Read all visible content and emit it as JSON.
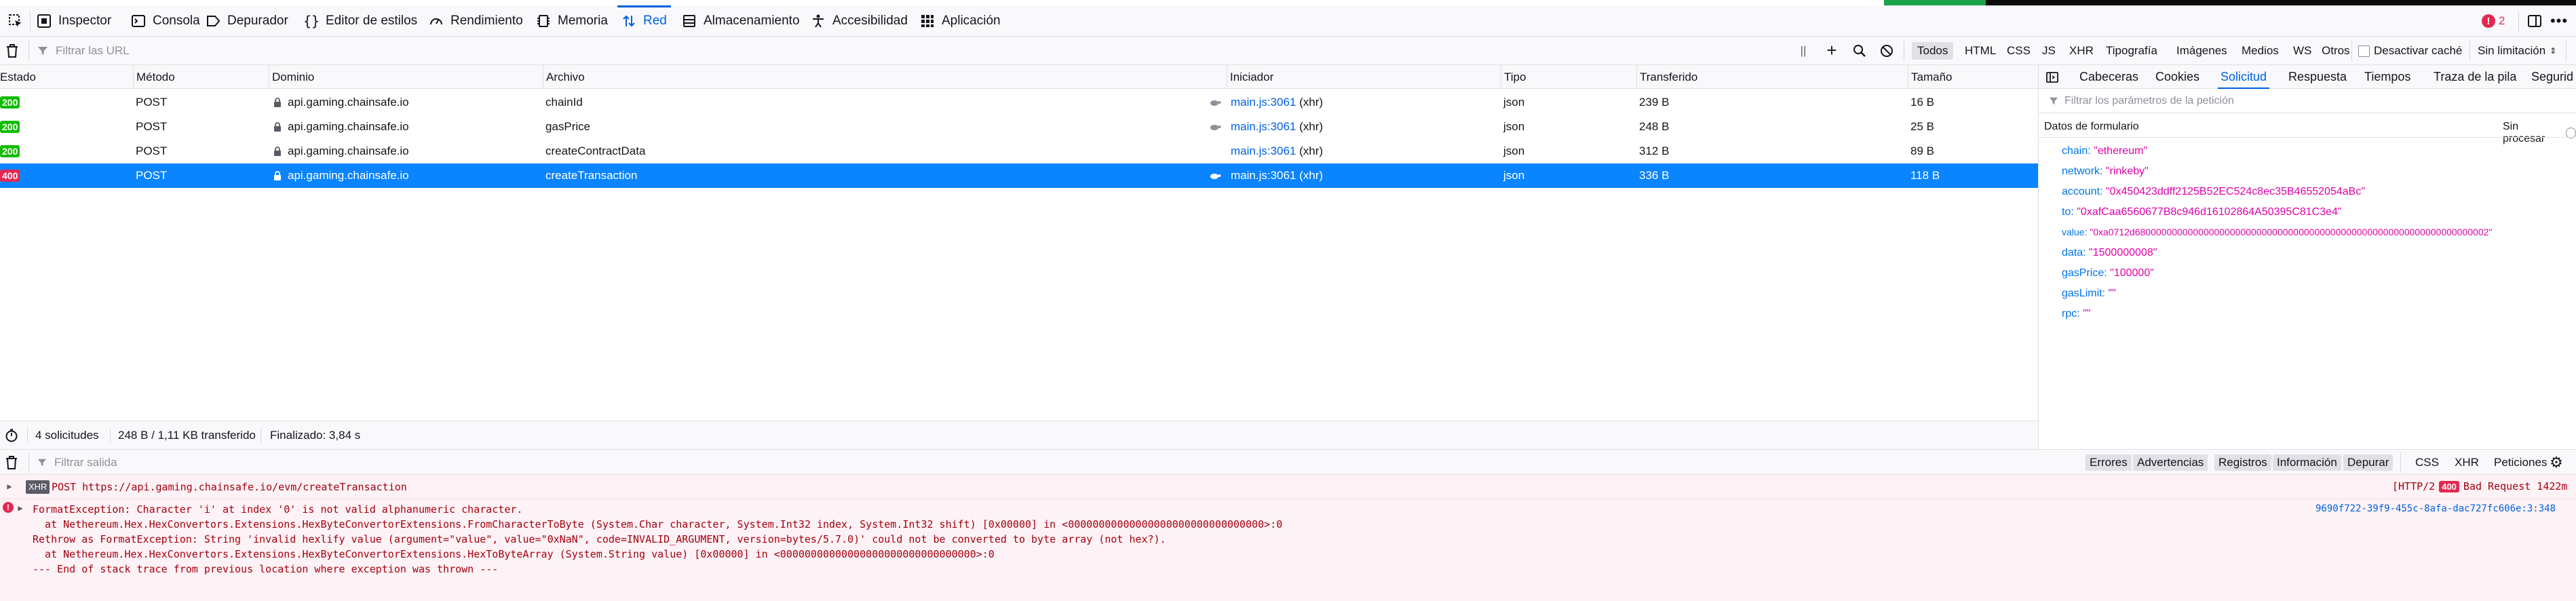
{
  "toolbox": {
    "tabs": [
      {
        "label": "Inspector",
        "icon": "inspector-icon"
      },
      {
        "label": "Consola",
        "icon": "console-icon"
      },
      {
        "label": "Depurador",
        "icon": "debugger-icon"
      },
      {
        "label": "Editor de estilos",
        "icon": "braces-icon"
      },
      {
        "label": "Rendimiento",
        "icon": "gauge-icon"
      },
      {
        "label": "Memoria",
        "icon": "memory-icon"
      },
      {
        "label": "Red",
        "icon": "network-arrows-icon"
      },
      {
        "label": "Almacenamiento",
        "icon": "storage-icon"
      },
      {
        "label": "Accesibilidad",
        "icon": "accessibility-icon"
      },
      {
        "label": "Aplicación",
        "icon": "grid-icon"
      }
    ],
    "active_tab": "Red",
    "error_count": "2"
  },
  "filter": {
    "placeholder": "Filtrar las URL",
    "types": [
      "Todos",
      "HTML",
      "CSS",
      "JS",
      "XHR",
      "Tipografía",
      "Imágenes",
      "Medios",
      "WS",
      "Otros"
    ],
    "active_type": "Todos",
    "disable_cache": "Desactivar caché",
    "throttle": "Sin limitación"
  },
  "table": {
    "columns": [
      "Estado",
      "Método",
      "Dominio",
      "Archivo",
      "Iniciador",
      "Tipo",
      "Transferido",
      "Tamaño"
    ],
    "rows": [
      {
        "status": "200",
        "method": "POST",
        "domain": "api.gaming.chainsafe.io",
        "file": "chainId",
        "initiator": "main.js:3061",
        "initiator_type": "(xhr)",
        "type": "json",
        "transferred": "239 B",
        "size": "16 B"
      },
      {
        "status": "200",
        "method": "POST",
        "domain": "api.gaming.chainsafe.io",
        "file": "gasPrice",
        "initiator": "main.js:3061",
        "initiator_type": "(xhr)",
        "type": "json",
        "transferred": "248 B",
        "size": "25 B"
      },
      {
        "status": "200",
        "method": "POST",
        "domain": "api.gaming.chainsafe.io",
        "file": "createContractData",
        "initiator": "main.js:3061",
        "initiator_type": "(xhr)",
        "type": "json",
        "transferred": "312 B",
        "size": "89 B"
      },
      {
        "status": "400",
        "method": "POST",
        "domain": "api.gaming.chainsafe.io",
        "file": "createTransaction",
        "initiator": "main.js:3061",
        "initiator_type": "(xhr)",
        "type": "json",
        "transferred": "336 B",
        "size": "118 B"
      }
    ]
  },
  "statusbar": {
    "requests": "4 solicitudes",
    "transferred": "248 B / 1,11 KB transferido",
    "finished": "Finalizado: 3,84 s"
  },
  "sidebar": {
    "tabs": [
      "Cabeceras",
      "Cookies",
      "Solicitud",
      "Respuesta",
      "Tiempos",
      "Traza de la pila",
      "Segurid"
    ],
    "active_tab": "Solicitud",
    "filter_placeholder": "Filtrar los parámetros de la petición",
    "section_title": "Datos de formulario",
    "raw_toggle": "Sin procesar",
    "params": [
      {
        "key": "chain:",
        "value": "\"ethereum\""
      },
      {
        "key": "network:",
        "value": "\"rinkeby\""
      },
      {
        "key": "account:",
        "value": "\"0x450423ddff2125B52EC524c8ec35B46552054aBc\""
      },
      {
        "key": "to:",
        "value": "\"0xafCaa6560677B8c946d16102864A50395C81C3e4\""
      },
      {
        "key": "value:",
        "value": "\"0xa0712d6800000000000000000000000000000000000000000000000000000000000000002\""
      },
      {
        "key": "data:",
        "value": "\"1500000008\""
      },
      {
        "key": "gasPrice:",
        "value": "\"100000\""
      },
      {
        "key": "gasLimit:",
        "value": "\"\""
      },
      {
        "key": "rpc:",
        "value": "\"\""
      }
    ]
  },
  "console": {
    "filter_placeholder": "Filtrar salida",
    "levels": [
      "Errores",
      "Advertencias",
      "Registros",
      "Información",
      "Depurar"
    ],
    "categories": [
      "CSS",
      "XHR",
      "Peticiones"
    ],
    "network_message": {
      "tag": "XHR",
      "text": "POST https://api.gaming.chainsafe.io/evm/createTransaction",
      "protocol": "[HTTP/2",
      "status": "400",
      "status_text": "Bad Request 1422m"
    },
    "error_lines": [
      "FormatException: Character 'i' at index '0' is not valid alphanumeric character.",
      "  at Nethereum.Hex.HexConvertors.Extensions.HexByteConvertorExtensions.FromCharacterToByte (System.Char character, System.Int32 index, System.Int32 shift) [0x00000] in <00000000000000000000000000000000>:0",
      "Rethrow as FormatException: String 'invalid hexlify value (argument=\"value\", value=\"0xNaN\", code=INVALID_ARGUMENT, version=bytes/5.7.0)' could not be converted to byte array (not hex?).",
      "  at Nethereum.Hex.HexConvertors.Extensions.HexByteConvertorExtensions.HexToByteArray (System.String value) [0x00000] in <00000000000000000000000000000000>:0",
      "--- End of stack trace from previous location where exception was thrown ---"
    ],
    "error_source": "9690f722-39f9-455c-8afa-dac727fc606e:3:348"
  },
  "colors": {
    "accent": "#0061e0",
    "selected_row": "#0a84ff",
    "ok_badge": "#12bc00",
    "error_badge": "#e22850",
    "error_text": "#a4000f",
    "param_key": "#0074e8",
    "param_value": "#dd00a9"
  }
}
